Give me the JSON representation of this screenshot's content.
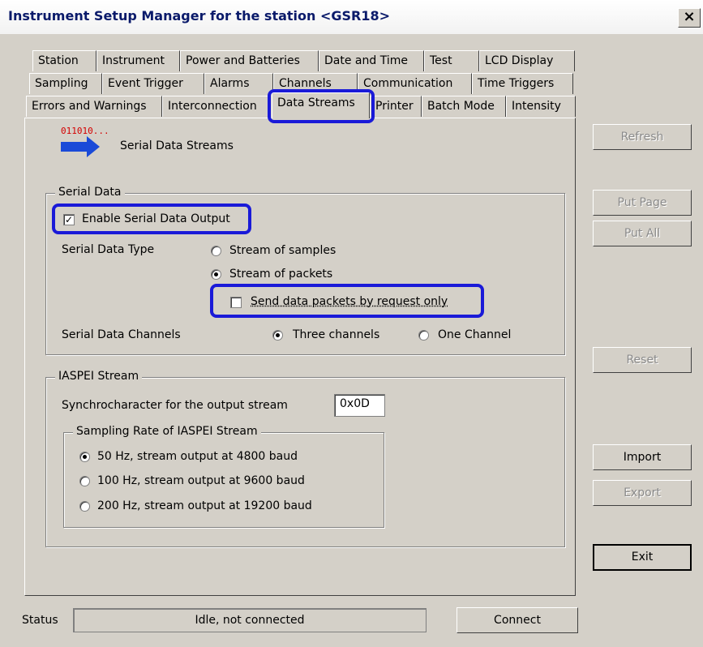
{
  "window": {
    "title": "Instrument Setup Manager for the station <GSR18>",
    "close_glyph": "×"
  },
  "tabs_row1": [
    "Station",
    "Instrument",
    "Power and Batteries",
    "Date and Time",
    "Test",
    "LCD Display"
  ],
  "tabs_row2": [
    "Sampling",
    "Event Trigger",
    "Alarms",
    "Channels",
    "Communication",
    "Time Triggers"
  ],
  "tabs_row3": [
    "Errors and Warnings",
    "Interconnection",
    "Data Streams",
    "Printer",
    "Batch Mode",
    "Intensity"
  ],
  "active_tab": "Data Streams",
  "header": {
    "icon_text": "011010...",
    "title": "Serial Data Streams"
  },
  "serial_data": {
    "group_label": "Serial Data",
    "enable_label": "Enable Serial Data Output",
    "enable_checked": true,
    "type_label": "Serial Data Type",
    "type_options": [
      "Stream of samples",
      "Stream of packets"
    ],
    "type_selected": "Stream of packets",
    "request_only_label": "Send data packets by request only",
    "request_only_checked": false,
    "channels_label": "Serial Data Channels",
    "channel_options": [
      "Three channels",
      "One Channel"
    ],
    "channel_selected": "Three channels"
  },
  "iaspei": {
    "group_label": "IASPEI Stream",
    "sync_label": "Synchrocharacter for the output stream",
    "sync_value": "0x0D",
    "rate_group_label": "Sampling Rate of IASPEI Stream",
    "rate_options": [
      "50 Hz, stream output at 4800 baud",
      "100 Hz, stream output at 9600 baud",
      "200 Hz, stream output at 19200 baud"
    ],
    "rate_selected": "50 Hz, stream output at 4800 baud"
  },
  "side_buttons": {
    "refresh": "Refresh",
    "put_page": "Put Page",
    "put_all": "Put All",
    "reset": "Reset",
    "import": "Import",
    "export": "Export",
    "exit": "Exit"
  },
  "status_bar": {
    "label": "Status",
    "text": "Idle, not connected",
    "connect": "Connect"
  },
  "colors": {
    "highlight": "#1a1ad8",
    "title_text": "#0a1a6a",
    "icon_red": "#d40000",
    "icon_blue": "#1a4ad8"
  }
}
